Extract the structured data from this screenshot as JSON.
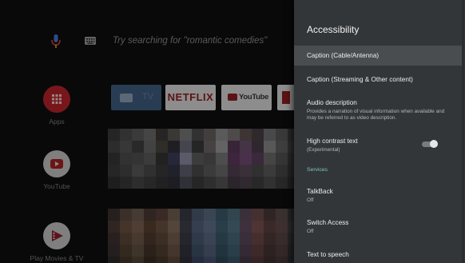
{
  "search": {
    "hint": "Try searching for \"romantic comedies\""
  },
  "apps": [
    {
      "label": "Apps",
      "icon": "apps-grid-icon",
      "color": "#c6282d"
    },
    {
      "label": "YouTube",
      "icon": "youtube-play-icon",
      "color": "#ffffff"
    },
    {
      "label": "Play Movies & TV",
      "icon": "play-movies-icon",
      "color": "#ffffff"
    }
  ],
  "channels": {
    "tv": "TV",
    "netflix": "NETFLIX",
    "youtube": "YouTube"
  },
  "panel": {
    "title": "Accessibility",
    "items": [
      {
        "title": "Caption (Cable/Antenna)"
      },
      {
        "title": "Caption (Streaming & Other content)"
      },
      {
        "title": "Audio description",
        "subtitle": "Provides a narration of visual information when available and may be referred to as video description."
      },
      {
        "title": "High contrast text",
        "subtitle": "(Experimental)"
      },
      {
        "title": "TalkBack",
        "subtitle": "Off"
      },
      {
        "title": "Switch Access",
        "subtitle": "Off"
      },
      {
        "title": "Text to speech"
      }
    ],
    "section_services": "Services",
    "high_contrast_enabled": false
  },
  "colors": {
    "accent": "#7fc7bd",
    "panel_bg": "#333638",
    "selected_bg": "#4a4d4f"
  }
}
